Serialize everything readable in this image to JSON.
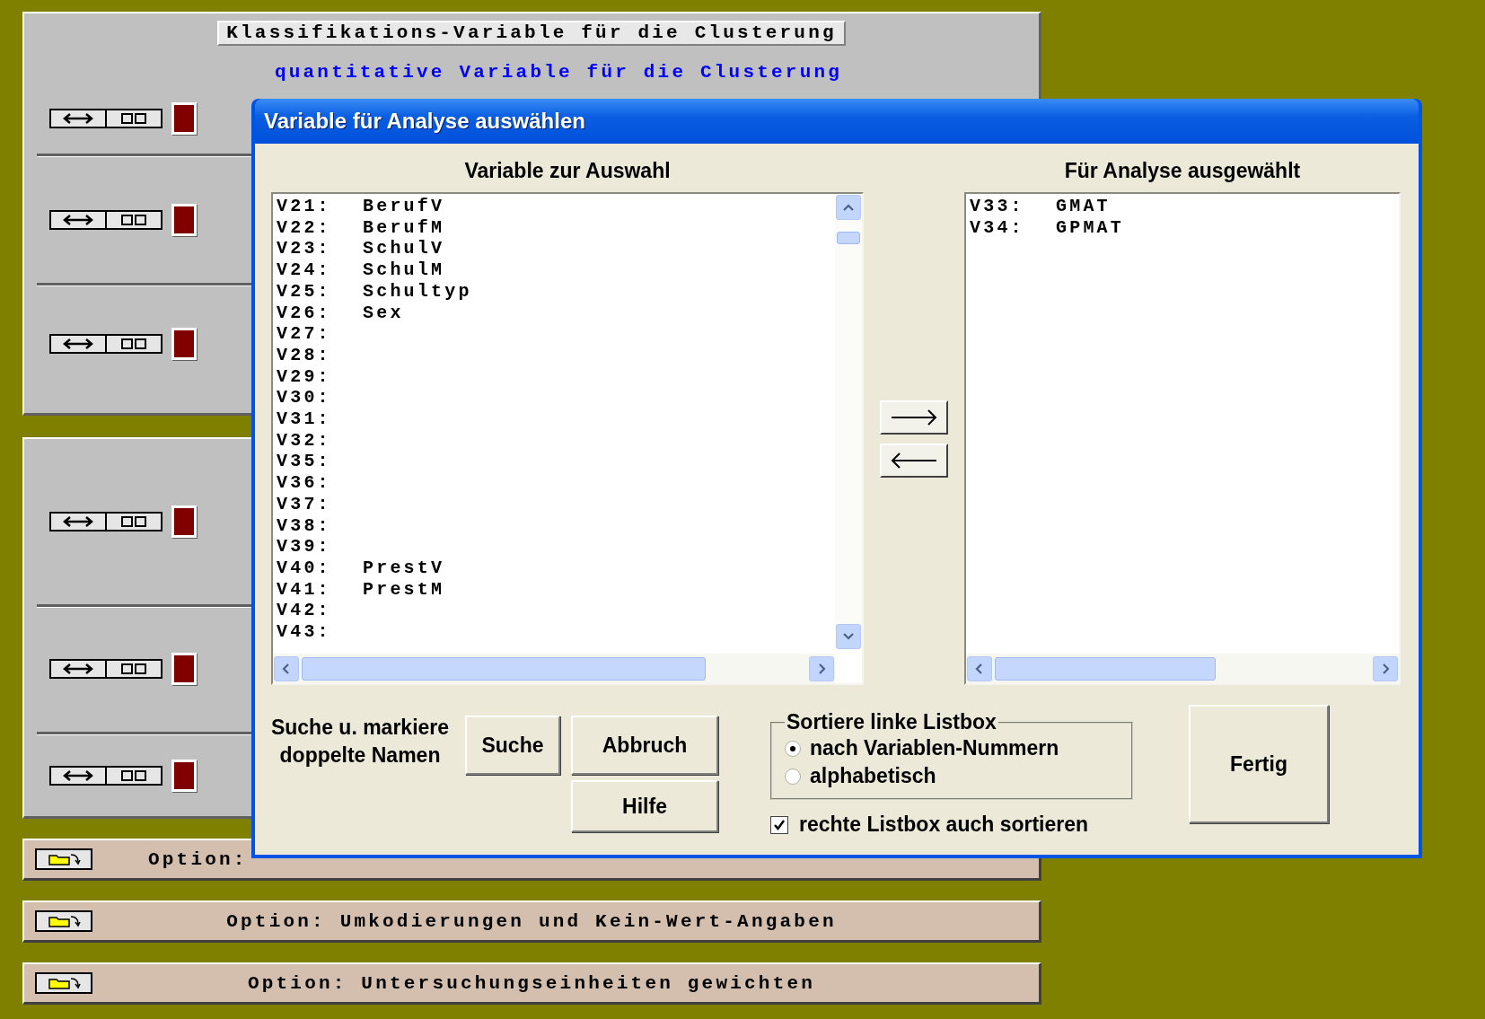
{
  "main": {
    "title": "Klassifikations-Variable für die Clusterung",
    "subtitle": "quantitative Variable für die Clusterung"
  },
  "options": [
    {
      "kind": "covered",
      "label": "Option:"
    },
    {
      "kind": "plain",
      "label": "Option: Umkodierungen und Kein-Wert-Angaben"
    },
    {
      "kind": "plain",
      "label": "Option: Untersuchungseinheiten gewichten"
    }
  ],
  "dialog": {
    "title": "Variable für Analyse auswählen",
    "left_list": {
      "heading": "Variable zur Auswahl",
      "items": [
        {
          "code": "V21:",
          "name": "BerufV"
        },
        {
          "code": "V22:",
          "name": "BerufM"
        },
        {
          "code": "V23:",
          "name": "SchulV"
        },
        {
          "code": "V24:",
          "name": "SchulM"
        },
        {
          "code": "V25:",
          "name": "Schultyp"
        },
        {
          "code": "V26:",
          "name": "Sex"
        },
        {
          "code": "V27:"
        },
        {
          "code": "V28:"
        },
        {
          "code": "V29:"
        },
        {
          "code": "V30:"
        },
        {
          "code": "V31:"
        },
        {
          "code": "V32:"
        },
        {
          "code": "V35:"
        },
        {
          "code": "V36:"
        },
        {
          "code": "V37:"
        },
        {
          "code": "V38:"
        },
        {
          "code": "V39:"
        },
        {
          "code": "V40:",
          "name": "PrestV"
        },
        {
          "code": "V41:",
          "name": "PrestM"
        },
        {
          "code": "V42:"
        },
        {
          "code": "V43:"
        }
      ]
    },
    "right_list": {
      "heading": "Für Analyse ausgewählt",
      "items": [
        {
          "code": "V33:",
          "name": "GMAT"
        },
        {
          "code": "V34:",
          "name": "GPMAT"
        }
      ]
    },
    "search_label": "Suche u. markiere doppelte Namen",
    "buttons": {
      "search": "Suche",
      "cancel": "Abbruch",
      "help": "Hilfe",
      "done": "Fertig"
    },
    "sort_group": {
      "legend": "Sortiere linke Listbox",
      "options": [
        {
          "label": "nach Variablen-Nummern",
          "selected": true
        },
        {
          "label": "alphabetisch",
          "selected": false
        }
      ]
    },
    "sort_right": {
      "label": "rechte Listbox auch sortieren",
      "checked": true
    }
  }
}
